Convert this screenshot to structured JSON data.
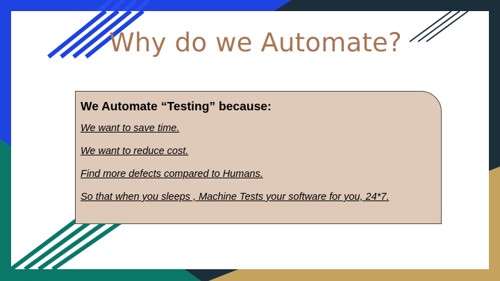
{
  "slide": {
    "title": "Why do we Automate?",
    "card": {
      "heading": "We Automate “Testing” because:",
      "points": [
        "We want to save time.",
        "We want to reduce cost.",
        "Find more defects compared to Humans.",
        "So that when you sleeps , Machine Tests your software for you, 24*7."
      ]
    }
  },
  "colors": {
    "title": "#a67554",
    "card_fill": "#dfc9b9",
    "navy": "#1b2f3b",
    "blue": "#1d43e0",
    "teal": "#0a7868",
    "gold": "#c4a35f"
  }
}
